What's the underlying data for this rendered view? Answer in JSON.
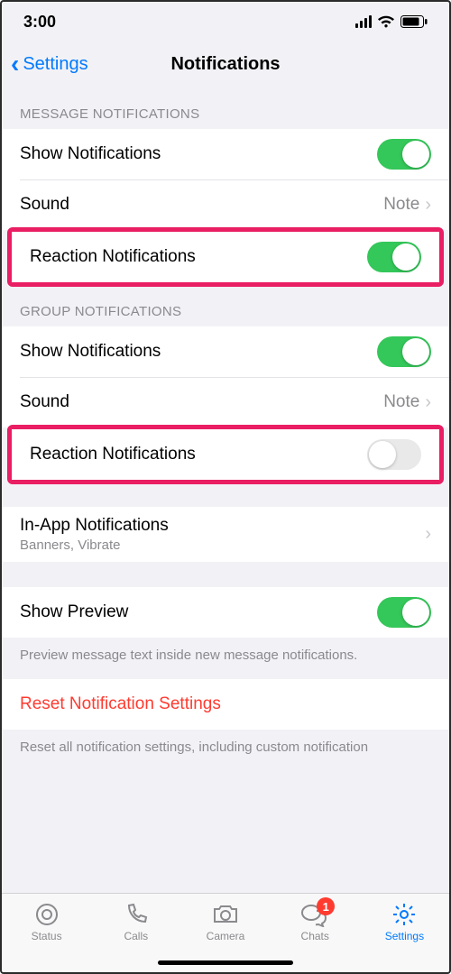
{
  "statusbar": {
    "time": "3:00"
  },
  "nav": {
    "back": "Settings",
    "title": "Notifications"
  },
  "sections": {
    "message_header": "MESSAGE NOTIFICATIONS",
    "group_header": "GROUP NOTIFICATIONS"
  },
  "message": {
    "show": {
      "label": "Show Notifications",
      "on": true
    },
    "sound": {
      "label": "Sound",
      "value": "Note"
    },
    "reaction": {
      "label": "Reaction Notifications",
      "on": true
    }
  },
  "group": {
    "show": {
      "label": "Show Notifications",
      "on": true
    },
    "sound": {
      "label": "Sound",
      "value": "Note"
    },
    "reaction": {
      "label": "Reaction Notifications",
      "on": false
    }
  },
  "inapp": {
    "label": "In-App Notifications",
    "sub": "Banners, Vibrate"
  },
  "preview": {
    "label": "Show Preview",
    "on": true,
    "footer": "Preview message text inside new message notifications."
  },
  "reset": {
    "label": "Reset Notification Settings",
    "footer": "Reset all notification settings, including custom notification"
  },
  "tabs": {
    "status": "Status",
    "calls": "Calls",
    "camera": "Camera",
    "chats": "Chats",
    "settings": "Settings",
    "badge": "1"
  }
}
